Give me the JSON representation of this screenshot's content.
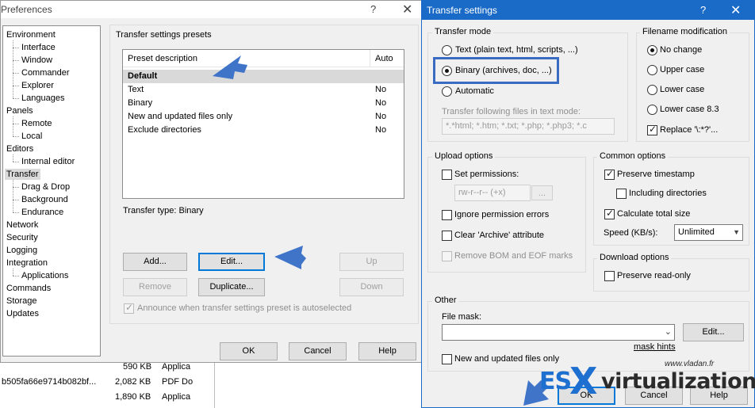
{
  "background_list": {
    "rows": [
      {
        "name": "",
        "size": "590 KB",
        "type": "Applica"
      },
      {
        "name": "b505fa66e9714b082bf...",
        "size": "2,082 KB",
        "type": "PDF Do"
      },
      {
        "name": "",
        "size": "1,890 KB",
        "type": "Applica"
      }
    ]
  },
  "preferences": {
    "title": "Preferences",
    "help_glyph": "?",
    "close_glyph": "✕",
    "tree": [
      {
        "label": "Environment",
        "level": 0
      },
      {
        "label": "Interface",
        "level": 1
      },
      {
        "label": "Window",
        "level": 1
      },
      {
        "label": "Commander",
        "level": 1
      },
      {
        "label": "Explorer",
        "level": 1
      },
      {
        "label": "Languages",
        "level": 1
      },
      {
        "label": "Panels",
        "level": 0
      },
      {
        "label": "Remote",
        "level": 1
      },
      {
        "label": "Local",
        "level": 1
      },
      {
        "label": "Editors",
        "level": 0
      },
      {
        "label": "Internal editor",
        "level": 1
      },
      {
        "label": "Transfer",
        "level": 0,
        "selected": true
      },
      {
        "label": "Drag & Drop",
        "level": 1
      },
      {
        "label": "Background",
        "level": 1
      },
      {
        "label": "Endurance",
        "level": 1
      },
      {
        "label": "Network",
        "level": 0
      },
      {
        "label": "Security",
        "level": 0
      },
      {
        "label": "Logging",
        "level": 0
      },
      {
        "label": "Integration",
        "level": 0
      },
      {
        "label": "Applications",
        "level": 1
      },
      {
        "label": "Commands",
        "level": 0
      },
      {
        "label": "Storage",
        "level": 0
      },
      {
        "label": "Updates",
        "level": 0
      }
    ],
    "presets_group_label": "Transfer settings presets",
    "columns": {
      "description": "Preset description",
      "auto": "Auto"
    },
    "presets": [
      {
        "description": "Default",
        "auto": "",
        "selected": true
      },
      {
        "description": "Text",
        "auto": "No"
      },
      {
        "description": "Binary",
        "auto": "No"
      },
      {
        "description": "New and updated files only",
        "auto": "No"
      },
      {
        "description": "Exclude directories",
        "auto": "No"
      }
    ],
    "transfer_type": "Transfer type: Binary",
    "buttons": {
      "add": "Add...",
      "edit": "Edit...",
      "up": "Up",
      "remove": "Remove",
      "duplicate": "Duplicate...",
      "down": "Down",
      "ok": "OK",
      "cancel": "Cancel",
      "help": "Help"
    },
    "announce_label": "Announce when transfer settings preset is autoselected"
  },
  "transfer_settings": {
    "title": "Transfer settings",
    "help_glyph": "?",
    "close_glyph": "✕",
    "mode_group": "Transfer mode",
    "mode_text": "Text (plain text, html, scripts, ...)",
    "mode_binary": "Binary (archives, doc, ...)",
    "mode_automatic": "Automatic",
    "text_mode_label": "Transfer following files in text mode:",
    "text_mode_mask": "*.*html; *.htm; *.txt; *.php; *.php3; *.c",
    "filename_group": "Filename modification",
    "fn_no_change": "No change",
    "fn_upper": "Upper case",
    "fn_lower": "Lower case",
    "fn_lower83": "Lower case 8.3",
    "fn_replace": "Replace '\\:*?'...",
    "upload_group": "Upload options",
    "set_permissions": "Set permissions:",
    "permissions_value": "rw-r--r-- (+x)",
    "permissions_btn": "...",
    "ignore_perm_errors": "Ignore permission errors",
    "clear_archive": "Clear 'Archive' attribute",
    "remove_bom": "Remove BOM and EOF marks",
    "common_group": "Common options",
    "preserve_timestamp": "Preserve timestamp",
    "including_dirs": "Including directories",
    "calc_total_size": "Calculate total size",
    "speed_label": "Speed (KB/s):",
    "speed_value": "Unlimited",
    "download_group": "Download options",
    "preserve_readonly": "Preserve read-only",
    "other_group": "Other",
    "file_mask_label": "File mask:",
    "file_mask_value": "",
    "edit_btn": "Edit...",
    "mask_hints": "mask hints",
    "new_updated_only": "New and updated files only",
    "ok": "OK",
    "cancel": "Cancel",
    "help": "Help"
  },
  "watermark": {
    "es": "ES",
    "x": "X",
    "virtualization": "virtualization",
    "url": "www.vladan.fr"
  },
  "colors": {
    "accent": "#1a6bc7",
    "annotation_arrow": "#3f74c9",
    "watermark_blue": "#1d6fd0"
  }
}
